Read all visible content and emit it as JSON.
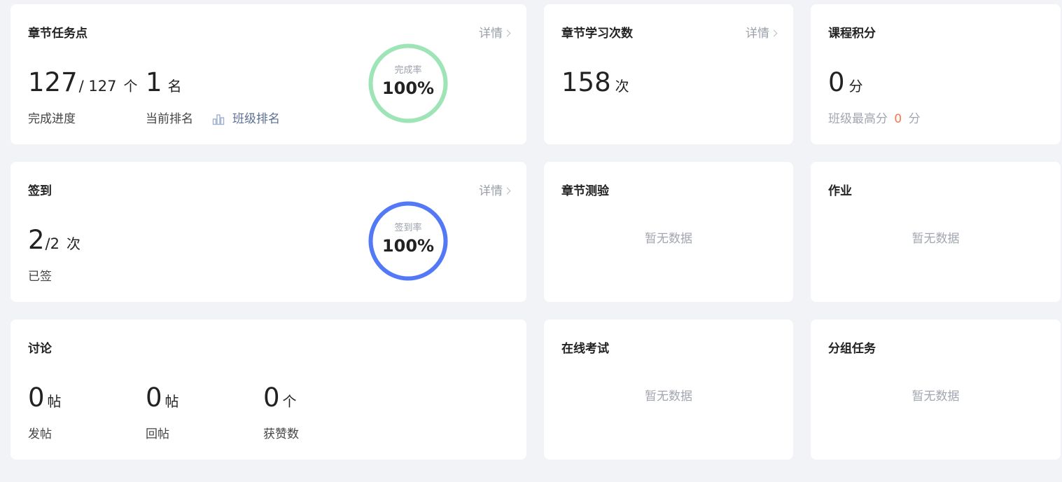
{
  "task_points": {
    "title": "章节任务点",
    "detail": "详情",
    "done": "127",
    "total": "/ 127",
    "unit": "个",
    "done_label": "完成进度",
    "rank": "1",
    "rank_unit": "名",
    "rank_label": "当前排名",
    "class_rank_link": "班级排名",
    "ring_label": "完成率",
    "ring_value": "100%",
    "ring_fraction": 1.0,
    "ring_color": "#9de4b6"
  },
  "study_count": {
    "title": "章节学习次数",
    "detail": "详情",
    "value": "158",
    "unit": "次"
  },
  "course_score": {
    "title": "课程积分",
    "value": "0",
    "unit": "分",
    "max_label": "班级最高分",
    "max_value": "0",
    "max_unit": "分"
  },
  "checkin": {
    "title": "签到",
    "detail": "详情",
    "done": "2",
    "total": "/2",
    "unit": "次",
    "label": "已签",
    "ring_label": "签到率",
    "ring_value": "100%",
    "ring_fraction": 1.0,
    "ring_color": "#5479f7"
  },
  "chapter_quiz": {
    "title": "章节测验",
    "empty": "暂无数据"
  },
  "homework": {
    "title": "作业",
    "empty": "暂无数据"
  },
  "discussion": {
    "title": "讨论",
    "posts": "0",
    "posts_unit": "帖",
    "posts_label": "发帖",
    "replies": "0",
    "replies_unit": "帖",
    "replies_label": "回帖",
    "likes": "0",
    "likes_unit": "个",
    "likes_label": "获赞数"
  },
  "online_exam": {
    "title": "在线考试",
    "empty": "暂无数据"
  },
  "group_task": {
    "title": "分组任务",
    "empty": "暂无数据"
  }
}
